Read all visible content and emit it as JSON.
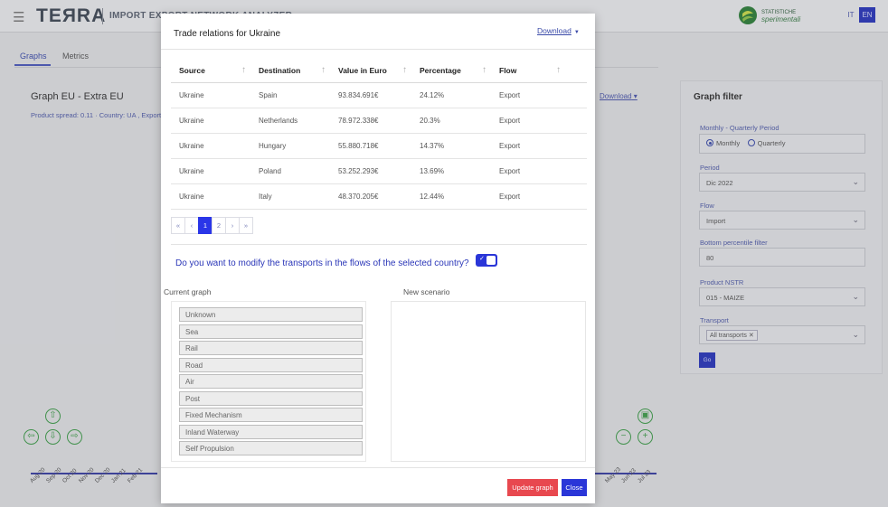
{
  "header": {
    "logo": "TEЯRA",
    "app_title": "IMPORT EXPORT NETWORK ANALYZER",
    "stat_logo_line1": "STATISTICHE",
    "stat_logo_line2": "sperimentali",
    "lang_it": "IT",
    "lang_en": "EN"
  },
  "tabs": [
    {
      "label": "Graphs"
    },
    {
      "label": "Metrics"
    }
  ],
  "graph": {
    "title": "Graph EU - Extra EU",
    "subtitle": "Product spread: 0.11 · Country: UA , Export",
    "download": "Download"
  },
  "timeline_labels": [
    "Aug 20",
    "Sep 20",
    "Oct 20",
    "Nov 20",
    "Dec 20",
    "Jan 21",
    "Feb 21",
    "May 23",
    "Jun 23",
    "Jul 23"
  ],
  "filter": {
    "title": "Graph filter",
    "period_type_label": "Monthly - Quarterly Period",
    "monthly": "Monthly",
    "quarterly": "Quarterly",
    "period_label": "Period",
    "period_value": "Dic 2022",
    "flow_label": "Flow",
    "flow_value": "Import",
    "percentile_label": "Bottom percentile filter",
    "percentile_value": "80",
    "product_label": "Product NSTR",
    "product_value": "015 - MAIZE",
    "transport_label": "Transport",
    "transport_value": "All transports",
    "go": "Go"
  },
  "modal": {
    "title": "Trade relations for Ukraine",
    "download": "Download",
    "columns": [
      "Source",
      "Destination",
      "Value in Euro",
      "Percentage",
      "Flow"
    ],
    "rows": [
      {
        "source": "Ukraine",
        "destination": "Spain",
        "value": "93.834.691€",
        "percentage": "24.12%",
        "flow": "Export"
      },
      {
        "source": "Ukraine",
        "destination": "Netherlands",
        "value": "78.972.338€",
        "percentage": "20.3%",
        "flow": "Export"
      },
      {
        "source": "Ukraine",
        "destination": "Hungary",
        "value": "55.880.718€",
        "percentage": "14.37%",
        "flow": "Export"
      },
      {
        "source": "Ukraine",
        "destination": "Poland",
        "value": "53.252.293€",
        "percentage": "13.69%",
        "flow": "Export"
      },
      {
        "source": "Ukraine",
        "destination": "Italy",
        "value": "48.370.205€",
        "percentage": "12.44%",
        "flow": "Export"
      }
    ],
    "pager": {
      "first": "«",
      "prev": "‹",
      "pages": [
        "1",
        "2"
      ],
      "next": "›",
      "last": "»"
    },
    "question": "Do you want to modify the transports in the flows of the selected country?",
    "current_graph_label": "Current graph",
    "new_scenario_label": "New scenario",
    "transports": [
      "Unknown",
      "Sea",
      "Rail",
      "Road",
      "Air",
      "Post",
      "Fixed Mechanism",
      "Inland Waterway",
      "Self Propulsion"
    ],
    "update_button": "Update graph",
    "close_button": "Close"
  },
  "colors": {
    "accent": "#2a36d8",
    "danger": "#e8484f",
    "nav_green": "#3f9a4a"
  }
}
